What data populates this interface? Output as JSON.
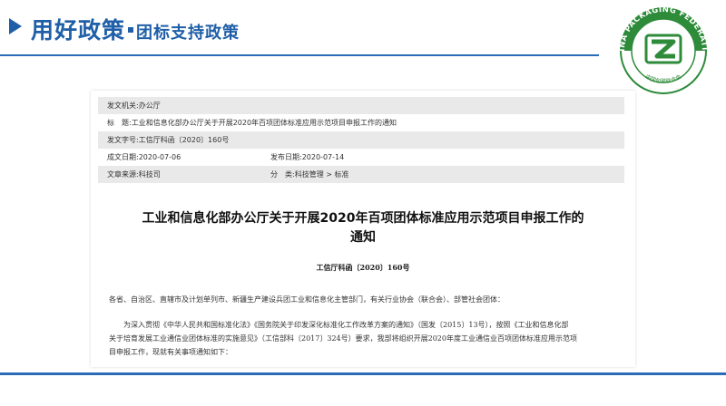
{
  "header": {
    "title": "用好政策",
    "subtitle": "团标支持政策"
  },
  "logo": {
    "text_top": "CHINA PACKAGING FEDERATION",
    "text_bottom": "中国包装联合会",
    "color": "#2e8b3a"
  },
  "document": {
    "meta": {
      "issuer_label": "发文机关:",
      "issuer_value": "办公厅",
      "subject_label": "标　题:",
      "subject_value": "工业和信息化部办公厅关于开展2020年百项团体标准应用示范项目申报工作的通知",
      "docno_label": "发文字号:",
      "docno_value": "工信厅科函〔2020〕160号",
      "date_label": "成文日期:",
      "date_value": "2020-07-06",
      "pub_label": "发布日期:",
      "pub_value": "2020-07-14",
      "source_label": "文章来源:",
      "source_value": "科技司",
      "category_label": "分　类:",
      "category_value": "科技管理 > 标准"
    },
    "title_line1": "工业和信息化部办公厅关于开展2020年百项团体标准应用示范项目申报工作的",
    "title_line2": "通知",
    "doc_number": "工信厅科函〔2020〕160号",
    "paragraphs": [
      "各省、自治区、直辖市及计划单列市、新疆生产建设兵团工业和信息化主管部门，有关行业协会（联合会）、部管社会团体：",
      "　　为深入贯彻《中华人民共和国标准化法》《国务院关于印发深化标准化工作改革方案的通知》（国发〔2015〕13号），按照《工业和信息化部",
      "关于培育发展工业通信业团体标准的实施意见》（工信部科〔2017〕324号）要求，我部将组织开展2020年度工业通信业百项团体标准应用示范项",
      "目申报工作，现就有关事项通知如下："
    ]
  }
}
